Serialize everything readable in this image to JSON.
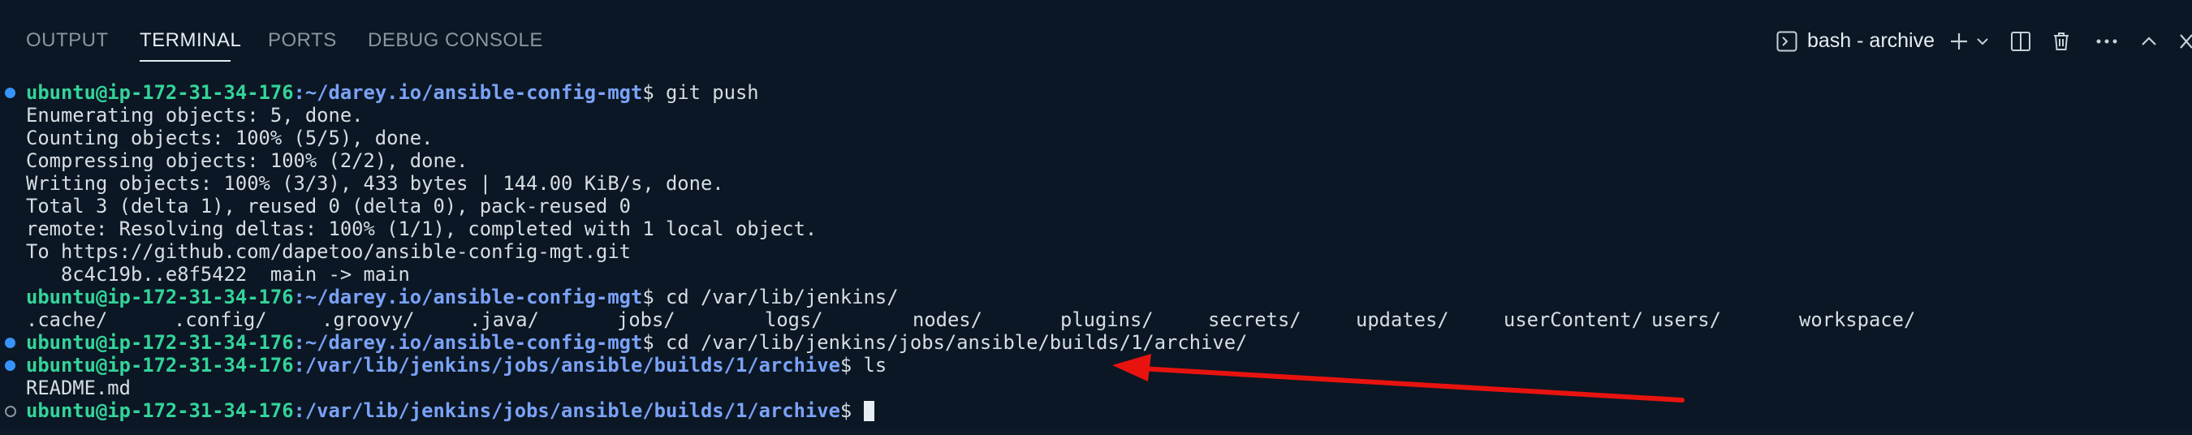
{
  "panel": {
    "tabs": [
      {
        "label": "OUTPUT",
        "active": false
      },
      {
        "label": "TERMINAL",
        "active": true
      },
      {
        "label": "PORTS",
        "active": false
      },
      {
        "label": "DEBUG CONSOLE",
        "active": false
      }
    ],
    "shell_label": "bash - archive",
    "icons": [
      "terminal-icon",
      "plus-icon",
      "chevron-down-icon",
      "split-icon",
      "trash-icon",
      "more-icon",
      "chevron-up-icon",
      "close-icon"
    ]
  },
  "terminal": {
    "prompt_user": "ubuntu@ip-172-31-34-176",
    "lines": {
      "l1_path": ":~/darey.io/ansible-config-mgt",
      "l1_cmd": "$ git push",
      "l2": "Enumerating objects: 5, done.",
      "l3": "Counting objects: 100% (5/5), done.",
      "l4": "Compressing objects: 100% (2/2), done.",
      "l5": "Writing objects: 100% (3/3), 433 bytes | 144.00 KiB/s, done.",
      "l6": "Total 3 (delta 1), reused 0 (delta 0), pack-reused 0",
      "l7": "remote: Resolving deltas: 100% (1/1), completed with 1 local object.",
      "l8": "To https://github.com/dapetoo/ansible-config-mgt.git",
      "l9": "   8c4c19b..e8f5422  main -> main",
      "l10_path": ":~/darey.io/ansible-config-mgt",
      "l10_cmd": "$ cd /var/lib/jenkins/",
      "ls_items": [
        ".cache/",
        ".config/",
        ".groovy/",
        ".java/",
        "jobs/",
        "logs/",
        "nodes/",
        "plugins/",
        "secrets/",
        "updates/",
        "userContent/",
        "users/",
        "workspace/"
      ],
      "l12_path": ":~/darey.io/ansible-config-mgt",
      "l12_cmd": "$ cd /var/lib/jenkins/jobs/ansible/builds/1/archive/",
      "l13_path": ":/var/lib/jenkins/jobs/ansible/builds/1/archive",
      "l13_cmd": "$ ls",
      "l14": "README.md",
      "l15_path": ":/var/lib/jenkins/jobs/ansible/builds/1/archive",
      "l15_cmd": "$ "
    }
  },
  "annotation": {
    "arrow_color": "#e8130f"
  },
  "colors": {
    "background": "#0b1724",
    "user_host": "#34d399",
    "path": "#7aa2f7",
    "text": "#d7dde3",
    "dot_blue": "#3794ff"
  }
}
